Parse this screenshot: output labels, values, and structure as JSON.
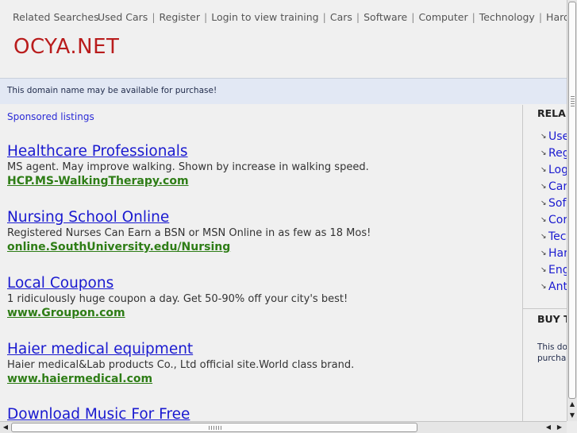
{
  "topnav": {
    "label": "Related Searches",
    "links": [
      "Used Cars",
      "Register",
      "Login to view training",
      "Cars",
      "Software",
      "Computer",
      "Technology",
      "Hardware"
    ]
  },
  "logo": "OCYA.NET",
  "domain_notice": "This domain name may be available for purchase!",
  "main": {
    "sponsored_label": "Sponsored listings",
    "listings": [
      {
        "title": "Healthcare Professionals",
        "desc": "MS agent. May improve walking. Shown by increase in walking speed.",
        "url": "HCP.MS-WalkingTherapy.com"
      },
      {
        "title": "Nursing School Online",
        "desc": "Registered Nurses Can Earn a BSN or MSN Online in as few as 18 Mos!",
        "url": "online.SouthUniversity.edu/Nursing"
      },
      {
        "title": "Local Coupons",
        "desc": "1 ridiculously huge coupon a day. Get 50-90% off your city's best!",
        "url": "www.Groupon.com"
      },
      {
        "title": "Haier medical equipment",
        "desc": "Haier medical&Lab products Co., Ltd official site.World class brand.",
        "url": "www.haiermedical.com"
      },
      {
        "title": "Download Music For Free",
        "desc": "",
        "url": ""
      }
    ]
  },
  "sidebar": {
    "heading": "RELA",
    "items": [
      "Use",
      "Reg",
      "Log",
      "Car",
      "Sof",
      "Cor",
      "Tec",
      "Har",
      "Eng",
      "Ant"
    ],
    "buy_heading": "BUY T",
    "buy_text_line1": "This do",
    "buy_text_line2": "purcha"
  }
}
